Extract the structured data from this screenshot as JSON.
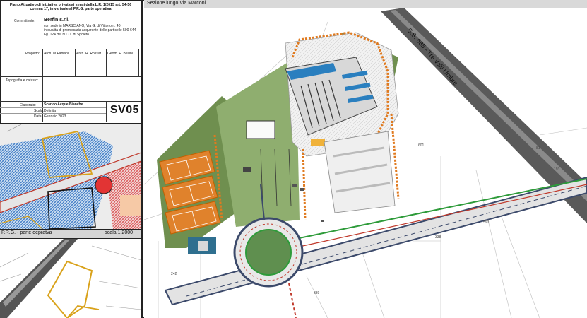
{
  "title_block": {
    "heading_line1": "Piano Attuativo di iniziativa privata ai sensi della L.R. 1/2015 art. 54-56",
    "heading_line2": "comma 17, in variante al P.R.G. parte operativa",
    "committente_label": "Committente:",
    "committente_name": "Berfin s.r.l.",
    "committente_line1": "con sede in MARSCIANO, Via G. di Vittorio n. 40",
    "committente_line2": "in qualità di promissaria acquirente delle particelle 500-644",
    "committente_line3": "Fg. 124 del N.C.T. di Spoleto",
    "progetto_label": "Progetto:",
    "designers": [
      "Arch. M.Fabiani",
      "Arch. R. Rossat",
      "Geom. E. Bellini"
    ],
    "topografia_label": "Topografia e catasto:",
    "elaborato_label": "Elaborato:",
    "elaborato_value": "Scarico Acque Bianche",
    "scala_label": "Scala:",
    "scala_value": "Definita",
    "data_label": "Data:",
    "data_value": "Gennaio 2023",
    "code": "SV05"
  },
  "inset": {
    "caption_left": "P.R.G. - parte oepratva",
    "caption_right": "scala 1:2000"
  },
  "main": {
    "title": "Sezione lungo Via Marconi",
    "road_label": "S.S. 685 - Tre Valli Umbre",
    "parcels": [
      "601",
      "338",
      "339",
      "242",
      "590",
      "193",
      "81"
    ]
  }
}
